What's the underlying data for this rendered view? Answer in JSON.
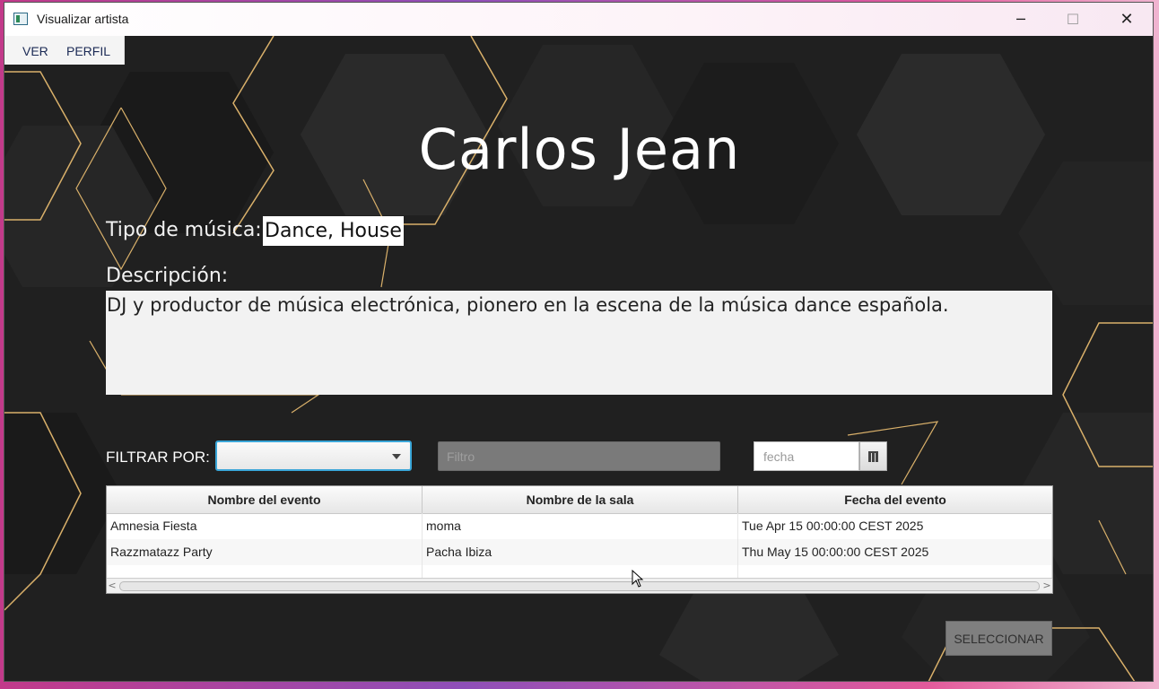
{
  "window": {
    "title": "Visualizar artista",
    "controls": {
      "minimize": "─",
      "maximize": "☐",
      "close": "✕"
    }
  },
  "menu": {
    "items": [
      "VER",
      "PERFIL"
    ]
  },
  "artist": {
    "name": "Carlos Jean",
    "genre_label": "Tipo de música:",
    "genre_value": "Dance, House",
    "description_label": "Descripción:",
    "description": "DJ y productor de música electrónica, pionero en la escena de la música dance española."
  },
  "filters": {
    "label": "FILTRAR POR:",
    "combo_value": "",
    "filter_placeholder": "Filtro",
    "date_placeholder": "fecha",
    "calendar_icon": "calendar-icon"
  },
  "events_table": {
    "columns": [
      "Nombre del evento",
      "Nombre de la sala",
      "Fecha del evento"
    ],
    "rows": [
      [
        "Amnesia Fiesta",
        "moma",
        "Tue Apr 15 00:00:00 CEST 2025"
      ],
      [
        "Razzmatazz Party",
        "Pacha Ibiza",
        "Thu May 15 00:00:00 CEST 2025"
      ]
    ],
    "scroll_left": "<",
    "scroll_right": ">"
  },
  "actions": {
    "select_label": "SELECCIONAR"
  },
  "colors": {
    "background": "#202020",
    "accent_gold": "#d9b06a",
    "focus_blue": "#3aa6d8"
  }
}
